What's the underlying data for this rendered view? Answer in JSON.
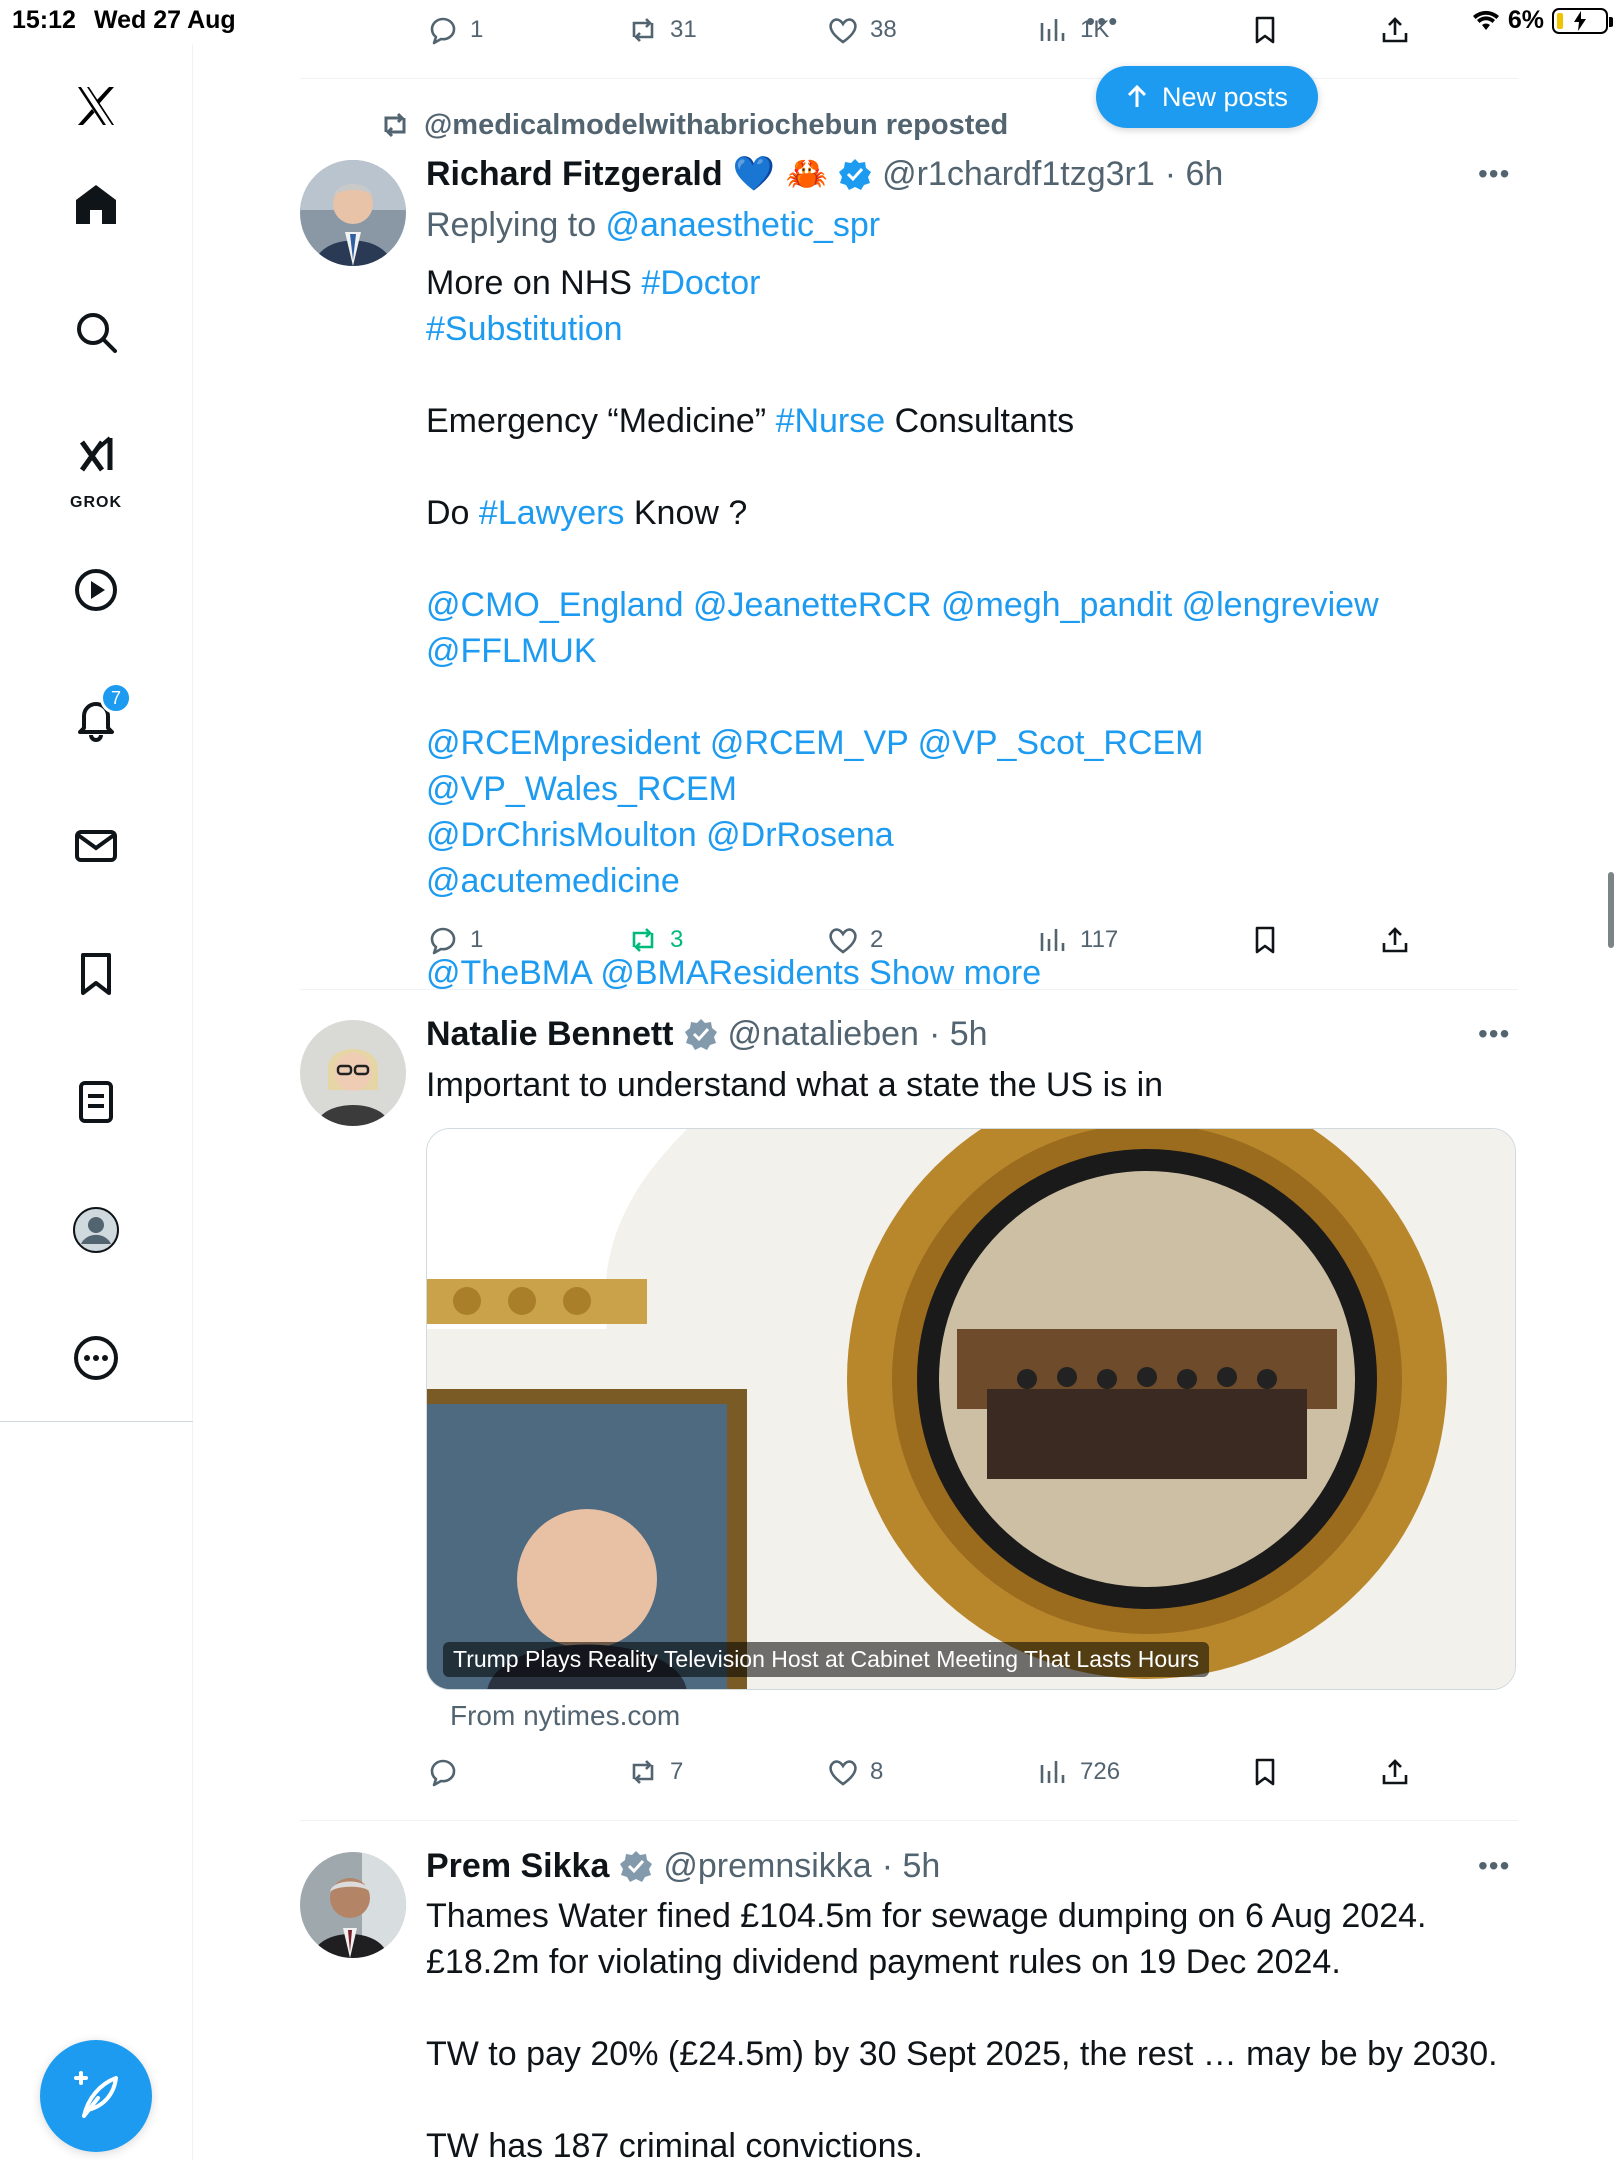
{
  "status_bar": {
    "time": "15:12",
    "date": "Wed 27 Aug",
    "battery": "6%"
  },
  "sidebar": {
    "items": [
      "Home",
      "Search",
      "Grok",
      "Videos",
      "Notifications",
      "Messages",
      "Bookmarks",
      "Lists",
      "Profile",
      "More"
    ],
    "grok_label": "GROK",
    "notifications_badge": "7"
  },
  "new_posts": {
    "label": "New posts"
  },
  "top_actions": {
    "replies": "1",
    "reposts": "31",
    "likes": "38",
    "views": "1K"
  },
  "posts": [
    {
      "reposted_by": "@medicalmodelwithabriochebun reposted",
      "name": "Richard Fitzgerald",
      "emoji": "💙 🦀",
      "handle": "@r1chardf1tzg3r1",
      "time": "· 6h",
      "replying_prefix": "Replying to ",
      "replying_to": "@anaesthetic_spr",
      "lines": {
        "l1_text": "More on  NHS ",
        "l1_tag": "#Doctor",
        "l2_tag": "#Substitution",
        "l3_text_a": "Emergency “Medicine” ",
        "l3_tag": "#Nurse",
        "l3_text_b": " Consultants",
        "l4_text_a": "Do ",
        "l4_tag": "#Lawyers",
        "l4_text_b": " Know ?",
        "l5": "@CMO_England @JeanetteRCR @megh_pandit @lengreview @FFLMUK",
        "l6": "@RCEMpresident @RCEM_VP @VP_Scot_RCEM @VP_Wales_RCEM",
        "l7": "@DrChrisMoulton @DrRosena",
        "l8": "@acutemedicine",
        "l9": "@TheBMA @BMAResidents Show more"
      },
      "actions": {
        "replies": "1",
        "reposts": "3",
        "likes": "2",
        "views": "117"
      }
    },
    {
      "name": "Natalie Bennett",
      "handle": "@natalieben",
      "time": "· 5h",
      "text": "Important to understand what a state the US is in",
      "card_caption": "Trump Plays Reality Television Host at Cabinet Meeting That Lasts Hours",
      "card_source": "From nytimes.com",
      "actions": {
        "replies": "",
        "reposts": "7",
        "likes": "8",
        "views": "726"
      }
    },
    {
      "name": "Prem Sikka",
      "handle": "@premnsikka",
      "time": "· 5h",
      "line1": "Thames Water fined £104.5m for sewage dumping on 6 Aug 2024.",
      "line2": "£18.2m for violating dividend payment rules on 19 Dec 2024.",
      "line3": "TW to pay 20% (£24.5m) by 30 Sept 2025, the rest … may be by 2030.",
      "line4": "TW has 187 criminal convictions."
    }
  ],
  "colors": {
    "accent": "#1d9bf0",
    "repost_green": "#00ba7c",
    "muted": "#536471"
  }
}
